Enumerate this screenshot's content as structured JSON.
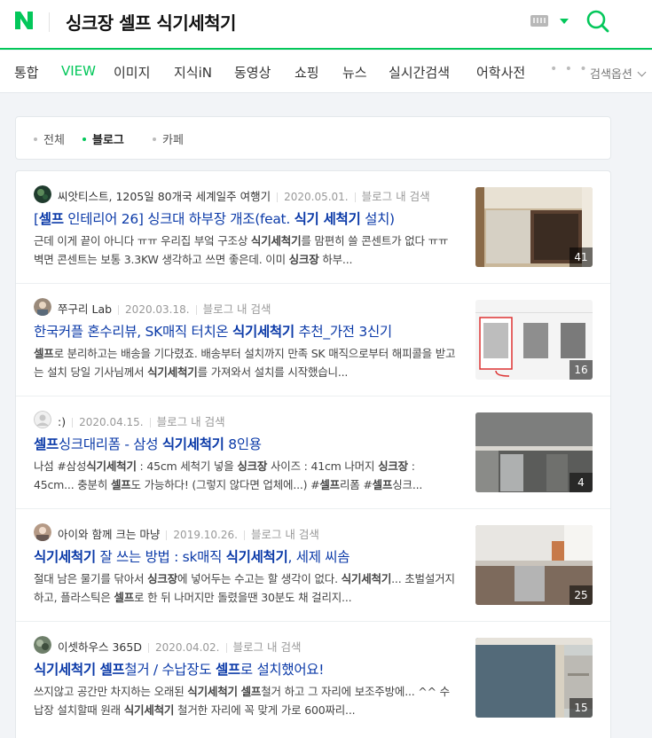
{
  "header": {
    "logo": "N",
    "query": "싱크장 셀프 식기세척기",
    "keyboard_icon": "keyboard-icon",
    "search_icon": "search-icon",
    "accent": "#03c75a"
  },
  "tabs": [
    {
      "label": "통합"
    },
    {
      "label": "VIEW",
      "active": true
    },
    {
      "label": "이미지"
    },
    {
      "label": "지식iN"
    },
    {
      "label": "동영상"
    },
    {
      "label": "쇼핑"
    },
    {
      "label": "뉴스"
    },
    {
      "label": "실시간검색"
    },
    {
      "label": "어학사전"
    }
  ],
  "more_dots": "• • •",
  "search_options": "검색옵션",
  "filter": [
    {
      "label": "전체"
    },
    {
      "label": "블로그",
      "selected": true
    },
    {
      "label": "카페"
    }
  ],
  "results": [
    {
      "author": "씨앗티스트, 1205일 80개국 세계일주 여행기",
      "date": "2020.05.01.",
      "blog_search": "블로그 내 검색",
      "title": "[셀프 인테리어 26] 싱크대 하부장 개조(feat. 식기 세척기 설치)",
      "desc": "근데 이게 끝이 아니다 ㅠㅠ 우리집 부엌 구조상 식기세척기를 맘편히 쓸 콘센트가 없다 ㅠㅠ 벽면 콘센트는 보통 3.3KW 생각하고 쓰면 좋은데. 이미 싱크장 하부...",
      "count": "41"
    },
    {
      "author": "쭈구리 Lab",
      "date": "2020.03.18.",
      "blog_search": "블로그 내 검색",
      "title": "한국커플 혼수리뷰, SK매직 터치온 식기세척기 추천_가전 3신기",
      "desc": "셀프로 분리하고는 배송을 기다렸죠. 배송부터 설치까지 만족 SK 매직으로부터 해피콜을 받고는 설치 당일 기사님께서 식기세척기를 가져와서 설치를 시작했습니...",
      "count": "16"
    },
    {
      "author": ":)",
      "date": "2020.04.15.",
      "blog_search": "블로그 내 검색",
      "title": "셀프싱크대리폼 - 삼성 식기세척기 8인용",
      "desc": "나섬 #삼성식기세척기 : 45cm 세척기 넣을 싱크장 사이즈 : 41cm 나머지 싱크장 : 45cm... 충분히 셀프도 가능하다! (그렇지 않다면 업체에...) #셀프리폼 #셀프싱크...",
      "count": "4"
    },
    {
      "author": "아이와 함께 크는 마냥",
      "date": "2019.10.26.",
      "blog_search": "블로그 내 검색",
      "title": "식기세척기 잘 쓰는 방법 : sk매직 식기세척기, 세제 씨솜",
      "desc": "절대 남은 물기를 닦아서 싱크장에 넣어두는 수고는 할 생각이 없다. 식기세척기... 초벌설거지 하고, 플라스틱은 셀프로 한 뒤 나머지만 돌렸을땐 30분도 채 걸리지...",
      "count": "25"
    },
    {
      "author": "이셋하우스 365D",
      "date": "2020.04.02.",
      "blog_search": "블로그 내 검색",
      "title": "식기세척기 셀프철거 / 수납장도 셀프로 설치했어요!",
      "desc": "쓰지않고 공간만 차지하는 오래된 식기세척기 셀프철거 하고 그 자리에 보조주방에... ^^ 수납장 설치할때 원래 식기세척기 철거한 자리에 꼭 맞게 가로 600짜리...",
      "count": "15"
    }
  ]
}
